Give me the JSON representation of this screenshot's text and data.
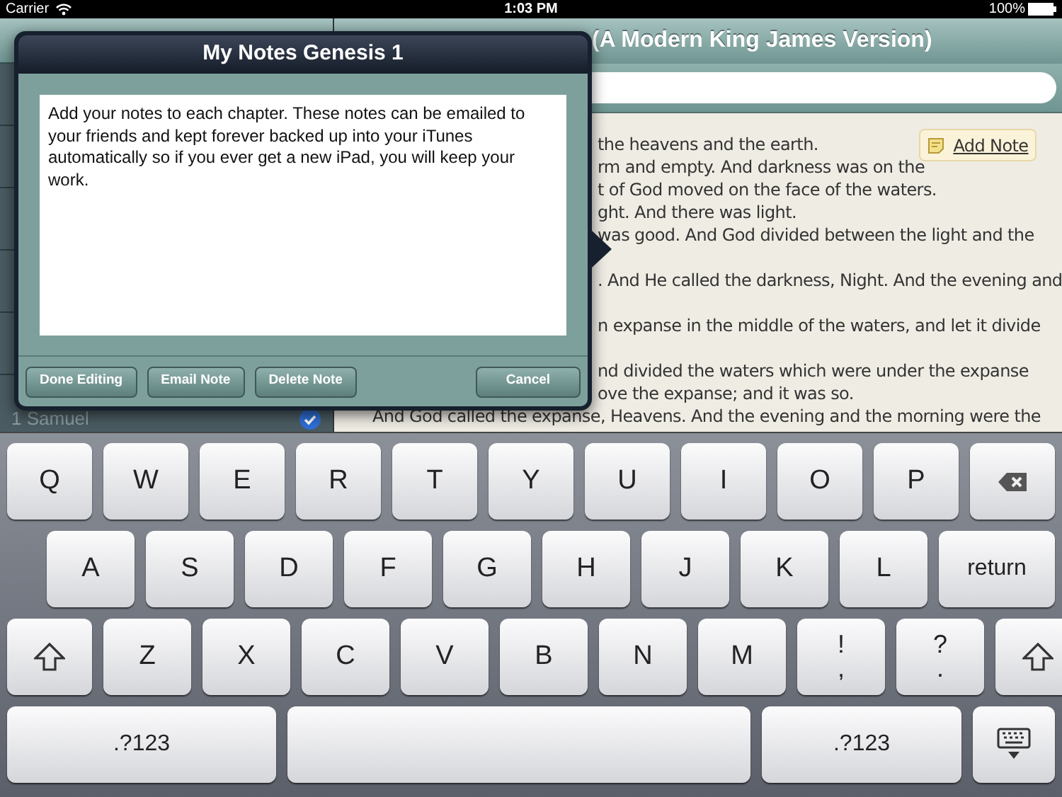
{
  "status_bar": {
    "carrier": "Carrier",
    "time": "1:03 PM",
    "battery": "100%"
  },
  "nav_bar": {
    "title": "(A Modern King James Version)"
  },
  "sidebar": {
    "items": [
      {
        "label": "1 Samuel",
        "checked": true
      }
    ]
  },
  "reader": {
    "add_note": "Add Note",
    "blocks": [
      {
        "lines": [
          {
            "text": "the heavens and the earth.",
            "kind": "partial"
          },
          {
            "text": "rm and empty. And darkness was on the",
            "kind": "partial"
          },
          {
            "text": "t of God moved on the face of the waters.",
            "kind": "partial"
          },
          {
            "text": "ght. And there was light.",
            "kind": "partial"
          },
          {
            "text": "was good. And God divided between the light and the",
            "kind": "partial"
          }
        ]
      },
      {
        "lines": [
          {
            "text": ". And He called the darkness, Night. And the evening and",
            "kind": "partial"
          }
        ]
      },
      {
        "lines": [
          {
            "text": "n expanse in the middle of the waters, and let it divide",
            "kind": "partial"
          }
        ]
      },
      {
        "lines": [
          {
            "text": "nd divided the waters which were under the expanse",
            "kind": "partial"
          },
          {
            "text": "ove the expanse; and it was so.",
            "kind": "partial"
          },
          {
            "text": "And God called the expanse, Heavens. And the evening and the morning were the",
            "kind": "full"
          }
        ]
      }
    ]
  },
  "popover": {
    "title": "My Notes Genesis 1",
    "note": "Add your notes to each chapter. These notes can be emailed to your friends and kept forever backed up into your iTunes automatically so if you ever get a new iPad, you will keep your work.",
    "buttons": [
      {
        "label": "Done Editing",
        "kind": "left"
      },
      {
        "label": "Email Note",
        "kind": "left"
      },
      {
        "label": "Delete Note",
        "kind": "left"
      },
      {
        "label": "Cancel",
        "kind": "right"
      }
    ]
  },
  "keyboard": {
    "rows": [
      {
        "keys": [
          {
            "kind": "letter",
            "label": "Q"
          },
          {
            "kind": "letter",
            "label": "W"
          },
          {
            "kind": "letter",
            "label": "E"
          },
          {
            "kind": "letter",
            "label": "R"
          },
          {
            "kind": "letter",
            "label": "T"
          },
          {
            "kind": "letter",
            "label": "Y"
          },
          {
            "kind": "letter",
            "label": "U"
          },
          {
            "kind": "letter",
            "label": "I"
          },
          {
            "kind": "letter",
            "label": "O"
          },
          {
            "kind": "letter",
            "label": "P"
          },
          {
            "kind": "delete"
          }
        ]
      },
      {
        "keys": [
          {
            "kind": "letter",
            "label": "A"
          },
          {
            "kind": "letter",
            "label": "S"
          },
          {
            "kind": "letter",
            "label": "D"
          },
          {
            "kind": "letter",
            "label": "F"
          },
          {
            "kind": "letter",
            "label": "G"
          },
          {
            "kind": "letter",
            "label": "H"
          },
          {
            "kind": "letter",
            "label": "J"
          },
          {
            "kind": "letter",
            "label": "K"
          },
          {
            "kind": "letter",
            "label": "L"
          },
          {
            "kind": "return",
            "label": "return"
          }
        ]
      },
      {
        "keys": [
          {
            "kind": "shift"
          },
          {
            "kind": "letter",
            "label": "Z"
          },
          {
            "kind": "letter",
            "label": "X"
          },
          {
            "kind": "letter",
            "label": "C"
          },
          {
            "kind": "letter",
            "label": "V"
          },
          {
            "kind": "letter",
            "label": "B"
          },
          {
            "kind": "letter",
            "label": "N"
          },
          {
            "kind": "letter",
            "label": "M"
          },
          {
            "kind": "dual",
            "top": "!",
            "bottom": ","
          },
          {
            "kind": "dual",
            "top": "?",
            "bottom": "."
          },
          {
            "kind": "shift"
          }
        ]
      },
      {
        "keys": [
          {
            "kind": "symbols",
            "label": ".?123"
          },
          {
            "kind": "space"
          },
          {
            "kind": "symbols_right",
            "label": ".?123"
          },
          {
            "kind": "hide"
          }
        ]
      }
    ]
  }
}
